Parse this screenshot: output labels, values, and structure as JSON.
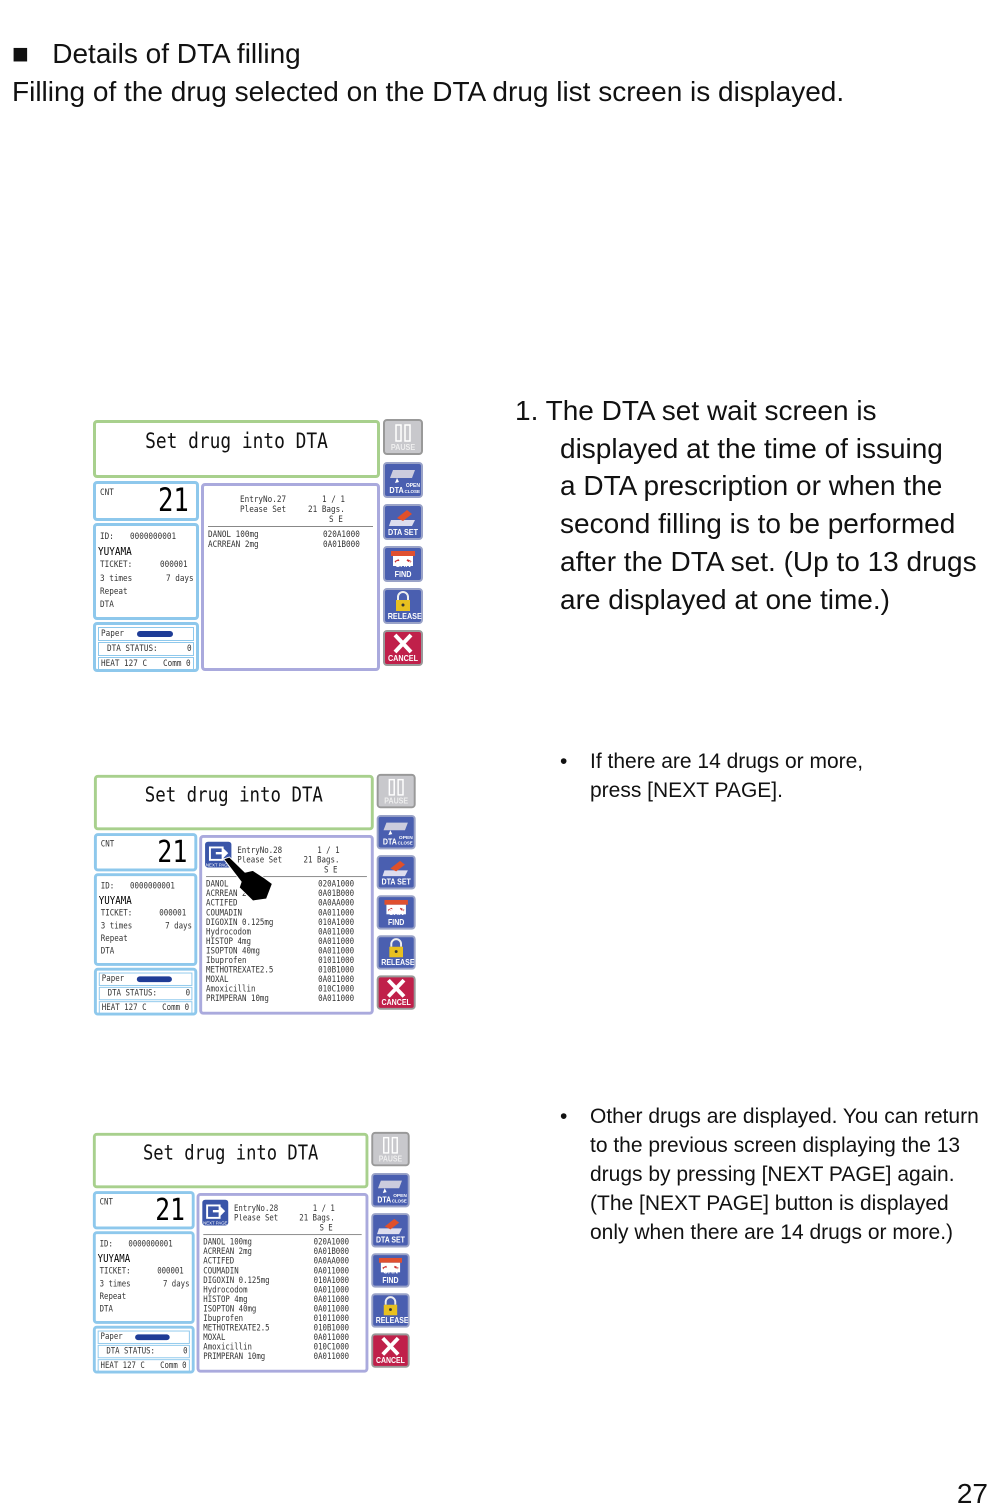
{
  "heading": {
    "bullet": "■",
    "title": "Details of DTA filling",
    "intro": "Filling of the drug selected on the DTA drug list screen is displayed."
  },
  "step1": {
    "lines": [
      "1. The DTA set wait screen is",
      "displayed at the time of issuing",
      "a DTA prescription or when the",
      "second  filling is to be performed",
      "after the DTA set.  (Up to 13 drugs",
      "are displayed at one time.)"
    ]
  },
  "note1": {
    "bullet": "•",
    "lines": [
      "If there are 14 drugs or more,",
      "press [NEXT PAGE]."
    ]
  },
  "note2": {
    "bullet": "•",
    "lines": [
      "Other drugs are displayed.  You can return",
      "to the previous screen displaying the 13",
      "drugs by pressing [NEXT PAGE] again.",
      "(The [NEXT PAGE] button is displayed",
      "only when there are 14 drugs or more.)"
    ]
  },
  "page_number": "27",
  "buttons": {
    "pause": "PAUSE",
    "dta_open_close": "DTA",
    "open": "OPEN",
    "close": "CLOSE",
    "dta_set": "DTA SET",
    "can_find": "CAN FIND",
    "release": "RELEASE",
    "cancel": "CANCEL",
    "next_page": "NEXT PAGE"
  },
  "colors": {
    "title_border": "#a8d08d",
    "info_border": "#8ec8ec",
    "list_border": "#aaaadd",
    "button_blue": "#4a5fb0",
    "cancel_red": "#c0204a",
    "paper_bar": "#1f3c96"
  },
  "screens": [
    {
      "title": "Set  drug into DTA",
      "cnt_label": "CNT",
      "cnt": "21",
      "id_label": "ID:",
      "id": "0000000001",
      "name": "YUYAMA",
      "ticket_label": "TICKET:",
      "ticket": "000001",
      "times": "3 times",
      "days": "7 days",
      "repeat": "Repeat",
      "dta": "DTA",
      "paper": "Paper",
      "dta_status_label": "DTA STATUS:",
      "dta_status": "0",
      "heat": "HEAT 127  C",
      "comm": "Comm 0",
      "entry": "EntryNo.27",
      "page": "1 / 1",
      "please_set": "Please Set",
      "bags": "21 Bags.",
      "se": "S  E",
      "next_page_shown": false,
      "hand_shown": false,
      "drugs": [
        [
          "DANOL 100mg",
          "020A1000"
        ],
        [
          "ACRREAN 2mg",
          "0A01B000"
        ]
      ]
    },
    {
      "title": "Set  drug into DTA",
      "cnt_label": "CNT",
      "cnt": "21",
      "id_label": "ID:",
      "id": "0000000001",
      "name": "YUYAMA",
      "ticket_label": "TICKET:",
      "ticket": "000001",
      "times": "3 times",
      "days": "7 days",
      "repeat": "Repeat",
      "dta": "DTA",
      "paper": "Paper",
      "dta_status_label": "DTA STATUS:",
      "dta_status": "0",
      "heat": "HEAT 127  C",
      "comm": "Comm 0",
      "entry": "EntryNo.28",
      "page": "1 / 1",
      "please_set": "Please Set",
      "bags": "21 Bags.",
      "se": "S  E",
      "next_page_shown": true,
      "hand_shown": true,
      "drugs": [
        [
          "DANOL",
          "020A1000"
        ],
        [
          "ACRREAN 2",
          "0A01B000"
        ],
        [
          "ACTIFED",
          "0A0AA000"
        ],
        [
          "COUMADIN",
          "0A011000"
        ],
        [
          "DIGOXIN 0.125mg",
          "010A1000"
        ],
        [
          "Hydrocodom",
          "0A011000"
        ],
        [
          "HISTOP 4mg",
          "0A011000"
        ],
        [
          "ISOPTON 40mg",
          "0A011000"
        ],
        [
          "Ibuprofen",
          "01011000"
        ],
        [
          "METHOTREXATE2.5",
          "010B1000"
        ],
        [
          "MOXAL",
          "0A011000"
        ],
        [
          "Amoxicillin",
          "010C1000"
        ],
        [
          "PRIMPERAN 10mg",
          "0A011000"
        ]
      ]
    },
    {
      "title": "Set  drug into DTA",
      "cnt_label": "CNT",
      "cnt": "21",
      "id_label": "ID:",
      "id": "0000000001",
      "name": "YUYAMA",
      "ticket_label": "TICKET:",
      "ticket": "000001",
      "times": "3 times",
      "days": "7 days",
      "repeat": "Repeat",
      "dta": "DTA",
      "paper": "Paper",
      "dta_status_label": "DTA STATUS:",
      "dta_status": "0",
      "heat": "HEAT 127  C",
      "comm": "Comm 0",
      "entry": "EntryNo.28",
      "page": "1 / 1",
      "please_set": "Please Set",
      "bags": "21 Bags.",
      "se": "S  E",
      "next_page_shown": true,
      "hand_shown": false,
      "drugs": [
        [
          "DANOL 100mg",
          "020A1000"
        ],
        [
          "ACRREAN 2mg",
          "0A01B000"
        ],
        [
          "ACTIFED",
          "0A0AA000"
        ],
        [
          "COUMADIN",
          "0A011000"
        ],
        [
          "DIGOXIN 0.125mg",
          "010A1000"
        ],
        [
          "Hydrocodom",
          "0A011000"
        ],
        [
          "HISTOP 4mg",
          "0A011000"
        ],
        [
          "ISOPTON 40mg",
          "0A011000"
        ],
        [
          "Ibuprofen",
          "01011000"
        ],
        [
          "METHOTREXATE2.5",
          "010B1000"
        ],
        [
          "MOXAL",
          "0A011000"
        ],
        [
          "Amoxicillin",
          "010C1000"
        ],
        [
          "PRIMPERAN 10mg",
          "0A011000"
        ]
      ]
    }
  ]
}
